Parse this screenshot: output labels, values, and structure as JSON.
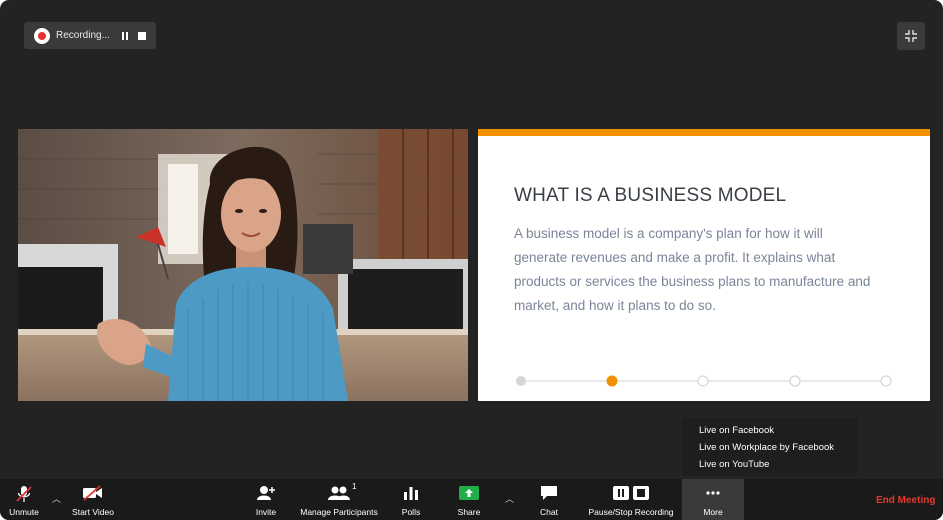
{
  "recording": {
    "label": "Recording...",
    "pause_icon": "pause-icon",
    "stop_icon": "stop-icon"
  },
  "fullscreen_icon": "exit-fullscreen-icon",
  "slide": {
    "title": "WHAT IS A BUSINESS MODEL",
    "body": "A business model is a company's plan for how it will generate revenues and make a profit. It explains what products or services the business plans to manufacture and market, and how it plans to do so.",
    "accent_color": "#f29100",
    "steps_total": 5,
    "current_step": 2
  },
  "live_menu": {
    "items": [
      "Live on Facebook",
      "Live on Workplace by Facebook",
      "Live on YouTube"
    ]
  },
  "toolbar": {
    "unmute": "Unmute",
    "start_video": "Start Video",
    "invite": "Invite",
    "manage_participants": "Manage Participants",
    "participants_count": "1",
    "polls": "Polls",
    "share": "Share",
    "chat": "Chat",
    "pause_stop_recording": "Pause/Stop Recording",
    "more": "More",
    "end_meeting": "End Meeting"
  },
  "colors": {
    "end_meeting": "#e23b2e",
    "share_green": "#1fae4a",
    "muted_red": "#e0332f"
  }
}
